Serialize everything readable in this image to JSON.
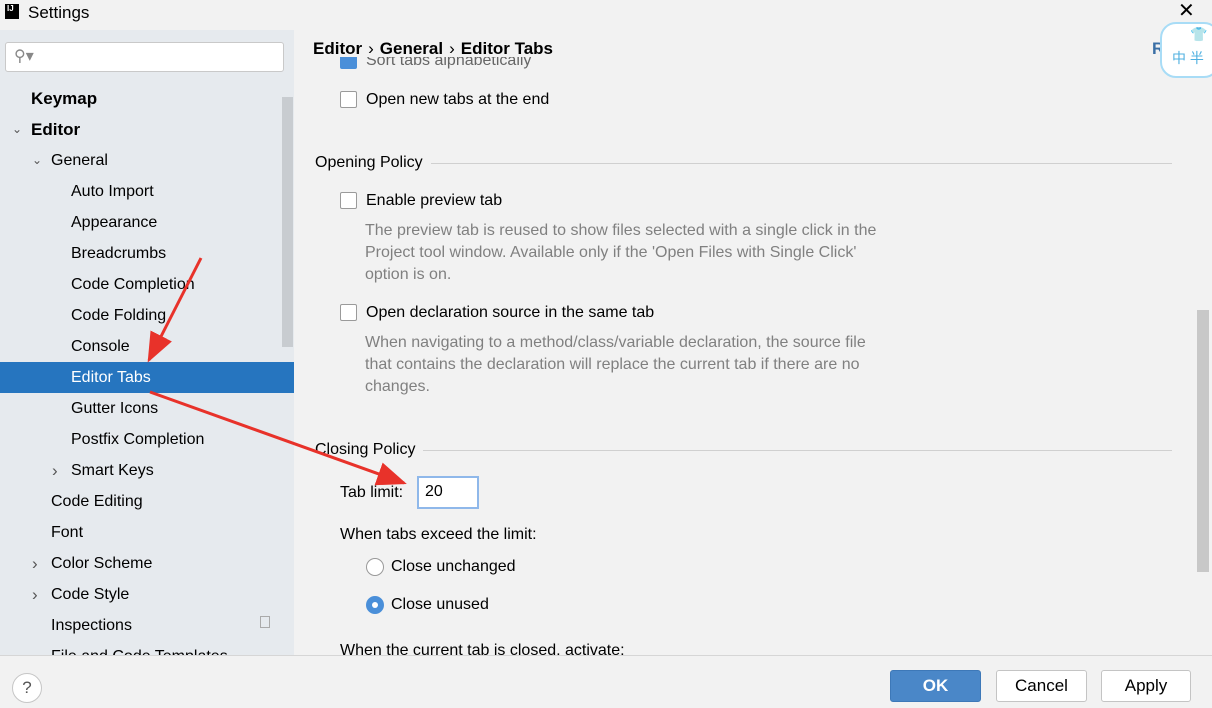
{
  "window": {
    "title": "Settings",
    "app_icon": "IJ",
    "close_icon": "close-icon"
  },
  "sidebar": {
    "search_placeholder": "",
    "items": [
      {
        "label": "Keymap",
        "bold": true,
        "indent": 0,
        "chevron": ""
      },
      {
        "label": "Editor",
        "bold": true,
        "indent": 0,
        "chevron": "down"
      },
      {
        "label": "General",
        "indent": 1,
        "chevron": "down"
      },
      {
        "label": "Auto Import",
        "indent": 2,
        "chevron": ""
      },
      {
        "label": "Appearance",
        "indent": 2,
        "chevron": ""
      },
      {
        "label": "Breadcrumbs",
        "indent": 2,
        "chevron": ""
      },
      {
        "label": "Code Completion",
        "indent": 2,
        "chevron": ""
      },
      {
        "label": "Code Folding",
        "indent": 2,
        "chevron": ""
      },
      {
        "label": "Console",
        "indent": 2,
        "chevron": ""
      },
      {
        "label": "Editor Tabs",
        "indent": 2,
        "chevron": "",
        "selected": true
      },
      {
        "label": "Gutter Icons",
        "indent": 2,
        "chevron": ""
      },
      {
        "label": "Postfix Completion",
        "indent": 2,
        "chevron": ""
      },
      {
        "label": "Smart Keys",
        "indent": 2,
        "chevron": "right"
      },
      {
        "label": "Code Editing",
        "indent": 1,
        "chevron": ""
      },
      {
        "label": "Font",
        "indent": 1,
        "chevron": ""
      },
      {
        "label": "Color Scheme",
        "indent": 1,
        "chevron": "right"
      },
      {
        "label": "Code Style",
        "indent": 1,
        "chevron": "right"
      },
      {
        "label": "Inspections",
        "indent": 1,
        "chevron": "",
        "copy_icon": true
      },
      {
        "label": "File and Code Templates",
        "indent": 1,
        "chevron": ""
      }
    ]
  },
  "breadcrumb": [
    "Editor",
    "General",
    "Editor Tabs"
  ],
  "main": {
    "sort_tabs": {
      "label": "Sort tabs alphabetically",
      "checked": true
    },
    "open_new_end": {
      "label": "Open new tabs at the end",
      "checked": false
    },
    "opening_policy": "Opening Policy",
    "preview_tab": {
      "label": "Enable preview tab",
      "checked": false,
      "desc": "The preview tab is reused to show files selected with a single click in the Project tool window. Available only if the 'Open Files with Single Click' option is on."
    },
    "decl_source": {
      "label": "Open declaration source in the same tab",
      "checked": false,
      "desc": "When navigating to a method/class/variable declaration, the source file that contains the declaration will replace the current tab if there are no changes."
    },
    "closing_policy": "Closing Policy",
    "tab_limit_label": "Tab limit:",
    "tab_limit_value": "20",
    "exceed_label": "When tabs exceed the limit:",
    "close_unchanged": {
      "label": "Close unchanged",
      "selected": false
    },
    "close_unused": {
      "label": "Close unused",
      "selected": true
    },
    "closed_activate": "When the current tab is closed, activate:",
    "reset_partial": "R"
  },
  "footer": {
    "help": "?",
    "ok": "OK",
    "cancel": "Cancel",
    "apply": "Apply"
  },
  "colors": {
    "accent": "#2675bf",
    "annotation_arrow": "#e8322a"
  }
}
